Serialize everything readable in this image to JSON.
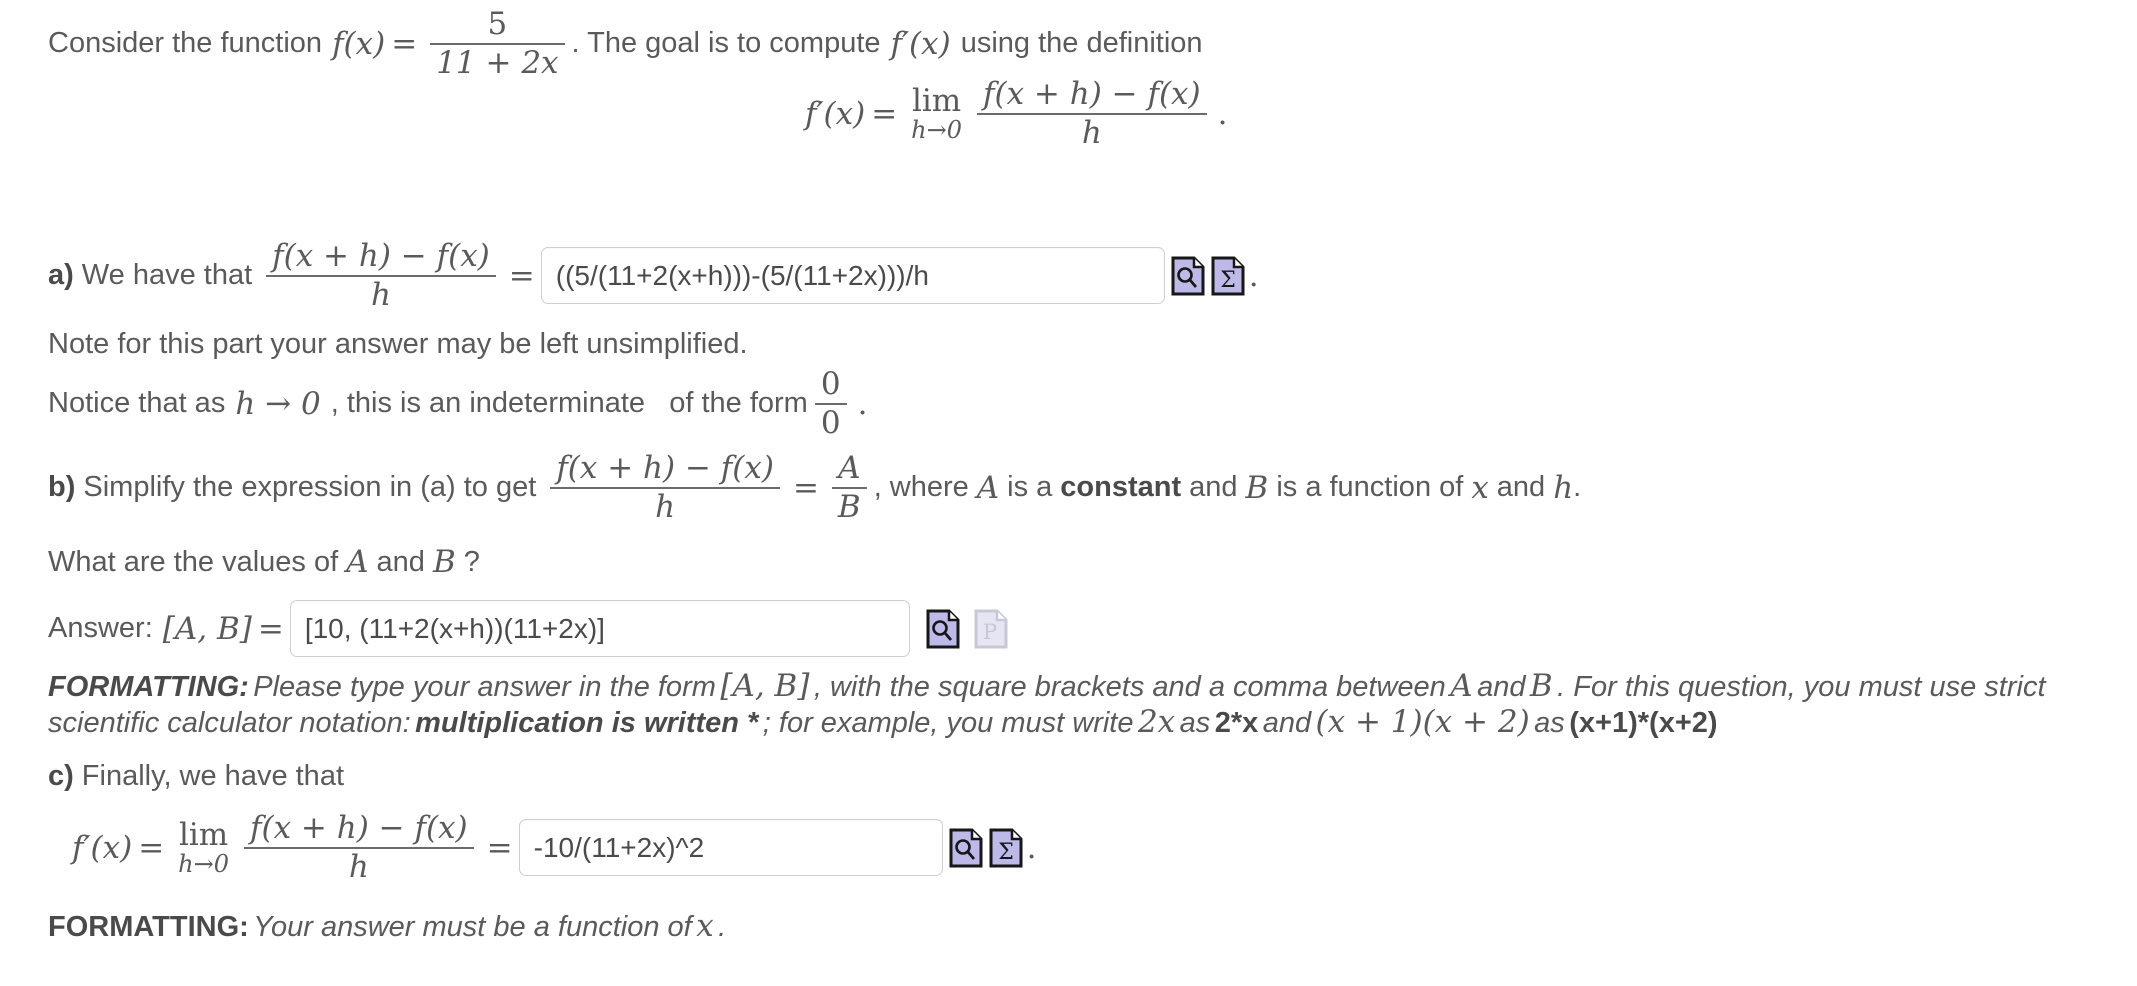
{
  "problem": {
    "intro_before": "Consider the function",
    "intro_fx": "f(x)",
    "intro_equals": "=",
    "intro_frac_num": "5",
    "intro_frac_den": "11 + 2x",
    "intro_after": ". The goal is to compute",
    "intro_fprime": "f′(x)",
    "intro_end": "using the definition"
  },
  "definition": {
    "lhs": "f′(x)",
    "equals": "=",
    "lim_main": "lim",
    "lim_sub": "h→0",
    "frac_num": "f(x + h) − f(x)",
    "frac_den": "h",
    "period": "."
  },
  "part_a": {
    "label": "a)",
    "text": "We have that",
    "frac_num": "f(x + h) − f(x)",
    "frac_den": "h",
    "equals": "=",
    "answer_value": "((5/(11+2(x+h)))-(5/(11+2x)))/h",
    "answer_placeholder": "",
    "period": ".",
    "note": "Note for this part your answer may be left unsimplified.",
    "icons": [
      {
        "name": "preview-answer-icon",
        "glyph": "magnifier",
        "state": "enabled"
      },
      {
        "name": "sigma-answer-icon",
        "glyph": "sigma",
        "state": "enabled"
      }
    ]
  },
  "indeterminate": {
    "text_1": "Notice that as",
    "math_h": "h → 0",
    "text_2": ", this is an indeterminate   of the form",
    "frac_num": "0",
    "frac_den": "0",
    "period": "."
  },
  "part_b": {
    "label": "b)",
    "text": "Simplify the expression in (a) to get",
    "frac_num": "f(x + h) − f(x)",
    "frac_den": "h",
    "equals": "=",
    "ab_num": "A",
    "ab_den": "B",
    "comma": ",",
    "where_1": "where",
    "math_A": "A",
    "where_2": "is a",
    "bold_constant": "constant",
    "where_3": "and",
    "math_B": "B",
    "where_4": "is a function of",
    "math_x": "x",
    "where_5": "and",
    "math_h2": "h",
    "where_end": ".",
    "question": "What are the values of",
    "question_A": "A",
    "question_and": "and",
    "question_B": "B",
    "question_mark": "?",
    "answer_label": "Answer:",
    "answer_label_math": "[A, B]",
    "answer_equals": "=",
    "answer_value": "[10, (11+2(x+h))(11+2x)]",
    "answer_placeholder": "",
    "icons": [
      {
        "name": "preview-answer-icon",
        "glyph": "magnifier",
        "state": "enabled"
      },
      {
        "name": "plot-answer-icon",
        "glyph": "p-letter",
        "state": "disabled"
      }
    ],
    "formatting_label": "FORMATTING:",
    "formatting_text_1": "Please type your answer in the form",
    "formatting_math_1": "[A, B]",
    "formatting_text_2": ", with the square brackets and a comma between",
    "formatting_math_2": "A",
    "formatting_text_3": "and",
    "formatting_math_3": "B",
    "formatting_text_4": ".  For this question, you must use strict scientific calculator notation:",
    "formatting_bold_1": "multiplication is written *",
    "formatting_text_5": "; for example, you must write",
    "formatting_math_4": "2x",
    "formatting_text_6": "as",
    "formatting_bold_2": "2*x",
    "formatting_text_7": "and",
    "formatting_math_5": "(x + 1)(x + 2)",
    "formatting_text_8": "as",
    "formatting_bold_3": "(x+1)*(x+2)"
  },
  "part_c": {
    "label": "c)",
    "text": "Finally, we have that",
    "lhs": "f′(x)",
    "equals_1": "=",
    "lim_main": "lim",
    "lim_sub": "h→0",
    "frac_num": "f(x + h) − f(x)",
    "frac_den": "h",
    "equals_2": "=",
    "answer_value": "-10/(11+2x)^2",
    "answer_placeholder": "",
    "period": ".",
    "icons": [
      {
        "name": "preview-answer-icon",
        "glyph": "magnifier",
        "state": "enabled"
      },
      {
        "name": "sigma-answer-icon",
        "glyph": "sigma",
        "state": "enabled"
      }
    ],
    "formatting_label": "FORMATTING:",
    "formatting_text": "Your answer must be a function of",
    "formatting_math": "x",
    "formatting_end": "."
  },
  "colors": {
    "text": "#5a5a5a",
    "bold_text": "#4a4a4a",
    "input_border": "#cfcfcf",
    "icon_fill": "#bdb9e8",
    "icon_stroke": "#171717",
    "icon_disabled_fill": "#e6e5f4",
    "icon_disabled_stroke": "#c8c8d4",
    "background": "#ffffff"
  }
}
